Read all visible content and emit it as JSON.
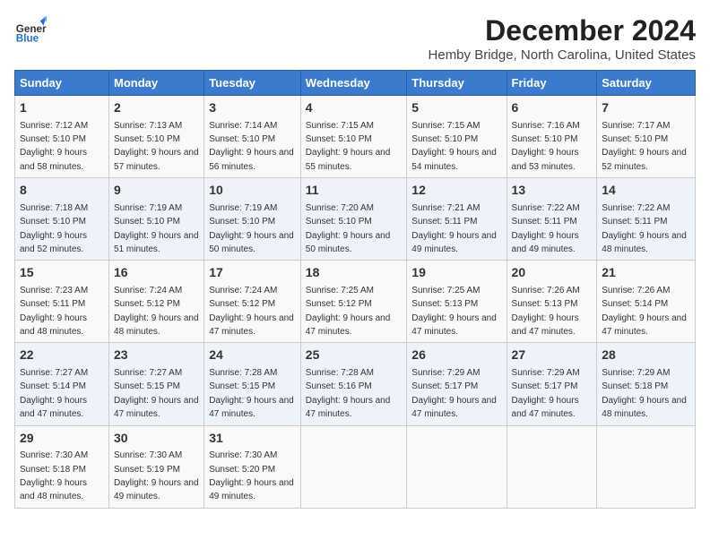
{
  "logo": {
    "line1": "General",
    "line2": "Blue"
  },
  "title": "December 2024",
  "location": "Hemby Bridge, North Carolina, United States",
  "days_of_week": [
    "Sunday",
    "Monday",
    "Tuesday",
    "Wednesday",
    "Thursday",
    "Friday",
    "Saturday"
  ],
  "weeks": [
    [
      {
        "num": "1",
        "sunrise": "7:12 AM",
        "sunset": "5:10 PM",
        "daylight": "9 hours and 58 minutes."
      },
      {
        "num": "2",
        "sunrise": "7:13 AM",
        "sunset": "5:10 PM",
        "daylight": "9 hours and 57 minutes."
      },
      {
        "num": "3",
        "sunrise": "7:14 AM",
        "sunset": "5:10 PM",
        "daylight": "9 hours and 56 minutes."
      },
      {
        "num": "4",
        "sunrise": "7:15 AM",
        "sunset": "5:10 PM",
        "daylight": "9 hours and 55 minutes."
      },
      {
        "num": "5",
        "sunrise": "7:15 AM",
        "sunset": "5:10 PM",
        "daylight": "9 hours and 54 minutes."
      },
      {
        "num": "6",
        "sunrise": "7:16 AM",
        "sunset": "5:10 PM",
        "daylight": "9 hours and 53 minutes."
      },
      {
        "num": "7",
        "sunrise": "7:17 AM",
        "sunset": "5:10 PM",
        "daylight": "9 hours and 52 minutes."
      }
    ],
    [
      {
        "num": "8",
        "sunrise": "7:18 AM",
        "sunset": "5:10 PM",
        "daylight": "9 hours and 52 minutes."
      },
      {
        "num": "9",
        "sunrise": "7:19 AM",
        "sunset": "5:10 PM",
        "daylight": "9 hours and 51 minutes."
      },
      {
        "num": "10",
        "sunrise": "7:19 AM",
        "sunset": "5:10 PM",
        "daylight": "9 hours and 50 minutes."
      },
      {
        "num": "11",
        "sunrise": "7:20 AM",
        "sunset": "5:10 PM",
        "daylight": "9 hours and 50 minutes."
      },
      {
        "num": "12",
        "sunrise": "7:21 AM",
        "sunset": "5:11 PM",
        "daylight": "9 hours and 49 minutes."
      },
      {
        "num": "13",
        "sunrise": "7:22 AM",
        "sunset": "5:11 PM",
        "daylight": "9 hours and 49 minutes."
      },
      {
        "num": "14",
        "sunrise": "7:22 AM",
        "sunset": "5:11 PM",
        "daylight": "9 hours and 48 minutes."
      }
    ],
    [
      {
        "num": "15",
        "sunrise": "7:23 AM",
        "sunset": "5:11 PM",
        "daylight": "9 hours and 48 minutes."
      },
      {
        "num": "16",
        "sunrise": "7:24 AM",
        "sunset": "5:12 PM",
        "daylight": "9 hours and 48 minutes."
      },
      {
        "num": "17",
        "sunrise": "7:24 AM",
        "sunset": "5:12 PM",
        "daylight": "9 hours and 47 minutes."
      },
      {
        "num": "18",
        "sunrise": "7:25 AM",
        "sunset": "5:12 PM",
        "daylight": "9 hours and 47 minutes."
      },
      {
        "num": "19",
        "sunrise": "7:25 AM",
        "sunset": "5:13 PM",
        "daylight": "9 hours and 47 minutes."
      },
      {
        "num": "20",
        "sunrise": "7:26 AM",
        "sunset": "5:13 PM",
        "daylight": "9 hours and 47 minutes."
      },
      {
        "num": "21",
        "sunrise": "7:26 AM",
        "sunset": "5:14 PM",
        "daylight": "9 hours and 47 minutes."
      }
    ],
    [
      {
        "num": "22",
        "sunrise": "7:27 AM",
        "sunset": "5:14 PM",
        "daylight": "9 hours and 47 minutes."
      },
      {
        "num": "23",
        "sunrise": "7:27 AM",
        "sunset": "5:15 PM",
        "daylight": "9 hours and 47 minutes."
      },
      {
        "num": "24",
        "sunrise": "7:28 AM",
        "sunset": "5:15 PM",
        "daylight": "9 hours and 47 minutes."
      },
      {
        "num": "25",
        "sunrise": "7:28 AM",
        "sunset": "5:16 PM",
        "daylight": "9 hours and 47 minutes."
      },
      {
        "num": "26",
        "sunrise": "7:29 AM",
        "sunset": "5:17 PM",
        "daylight": "9 hours and 47 minutes."
      },
      {
        "num": "27",
        "sunrise": "7:29 AM",
        "sunset": "5:17 PM",
        "daylight": "9 hours and 47 minutes."
      },
      {
        "num": "28",
        "sunrise": "7:29 AM",
        "sunset": "5:18 PM",
        "daylight": "9 hours and 48 minutes."
      }
    ],
    [
      {
        "num": "29",
        "sunrise": "7:30 AM",
        "sunset": "5:18 PM",
        "daylight": "9 hours and 48 minutes."
      },
      {
        "num": "30",
        "sunrise": "7:30 AM",
        "sunset": "5:19 PM",
        "daylight": "9 hours and 49 minutes."
      },
      {
        "num": "31",
        "sunrise": "7:30 AM",
        "sunset": "5:20 PM",
        "daylight": "9 hours and 49 minutes."
      },
      null,
      null,
      null,
      null
    ]
  ],
  "labels": {
    "sunrise_prefix": "Sunrise: ",
    "sunset_prefix": "Sunset: ",
    "daylight_prefix": "Daylight: "
  }
}
